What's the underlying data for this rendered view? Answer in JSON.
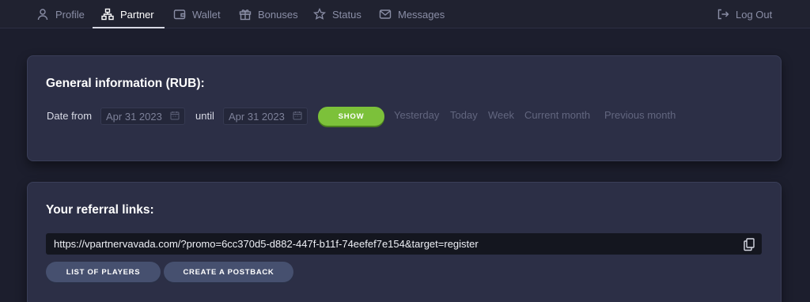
{
  "nav": {
    "items": [
      {
        "label": "Profile",
        "icon": "user-icon"
      },
      {
        "label": "Partner",
        "icon": "network-icon",
        "active": true
      },
      {
        "label": "Wallet",
        "icon": "wallet-icon"
      },
      {
        "label": "Bonuses",
        "icon": "gift-icon"
      },
      {
        "label": "Status",
        "icon": "star-icon"
      },
      {
        "label": "Messages",
        "icon": "mail-icon"
      }
    ],
    "logout_label": "Log Out"
  },
  "general": {
    "title": "General information (RUB):",
    "date_from_label": "Date from",
    "date_from_value": "Apr 31 2023",
    "until_label": "until",
    "date_until_value": "Apr 31 2023",
    "show_label": "SHOW",
    "quick_ranges": [
      "Yesterday",
      "Today",
      "Week",
      "Current month",
      "Previous month"
    ]
  },
  "referral": {
    "title": "Your referral links:",
    "link": "https://vpartnervavada.com/?promo=6cc370d5-d882-447f-b11f-74eefef7e154&target=register",
    "list_players_label": "LIST OF PLAYERS",
    "create_postback_label": "CREATE A POSTBACK"
  },
  "colors": {
    "background": "#1c1e2d",
    "card": "#2c2f46",
    "accent_green": "#7cc13a",
    "secondary_button": "#46506f"
  }
}
